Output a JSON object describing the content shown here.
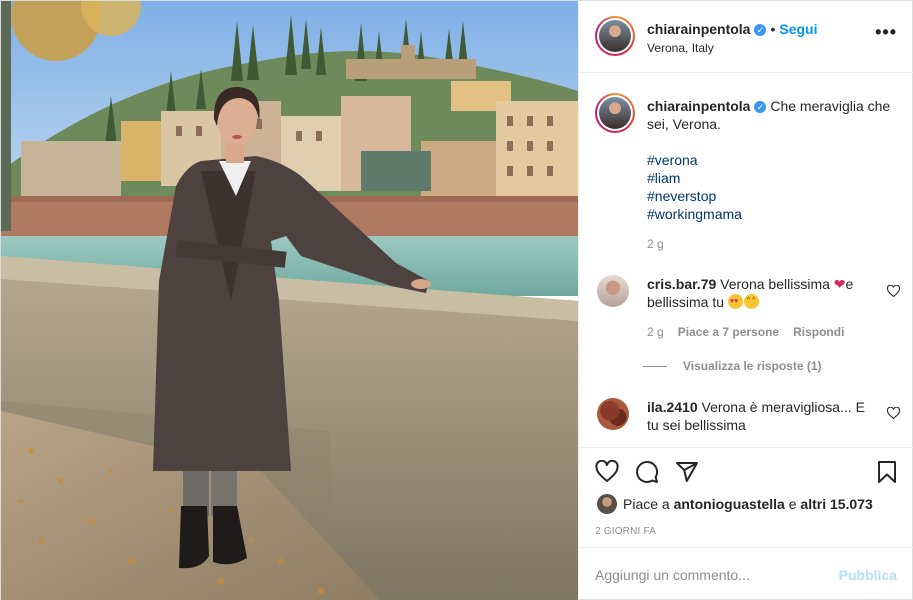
{
  "post": {
    "username": "chiarainpentola",
    "follow_label": "Segui",
    "location": "Verona, Italy",
    "caption": "Che meraviglia che sei, Verona.",
    "hashtags": [
      "#verona",
      "#liam",
      "#neverstop",
      "#workingmama"
    ],
    "caption_time": "2 g"
  },
  "comments": [
    {
      "username": "cris.bar.79",
      "text_line1": "Verona bellissima",
      "text_after_heart": "e",
      "text_line2": "bellissima tu",
      "time": "2 g",
      "likes": "Piace a 7 persone",
      "reply_label": "Rispondi",
      "view_replies": "Visualizza le risposte (1)"
    },
    {
      "username": "ila.2410",
      "text_line1": "Verona è meravigliosa... E",
      "text_line2": "tu sei bellissima"
    }
  ],
  "likes": {
    "prefix": "Piace a",
    "user": "antonioguastella",
    "middle": "e",
    "others": "altri 15.073"
  },
  "time_ago": "2 GIORNI FA",
  "add_comment": {
    "placeholder": "Aggiungi un commento...",
    "publish_label": "Pubblica"
  },
  "colors": {
    "accent": "#0095f6",
    "publish_disabled": "#b2dffc",
    "hashtag": "#00376b",
    "muted": "#8e8e8e"
  },
  "icons": [
    "verified-badge-icon",
    "more-options-icon",
    "heart-icon",
    "comment-icon",
    "share-icon",
    "bookmark-icon",
    "heart-emoji-icon",
    "smiling-heart-eyes-emoji-icon"
  ]
}
